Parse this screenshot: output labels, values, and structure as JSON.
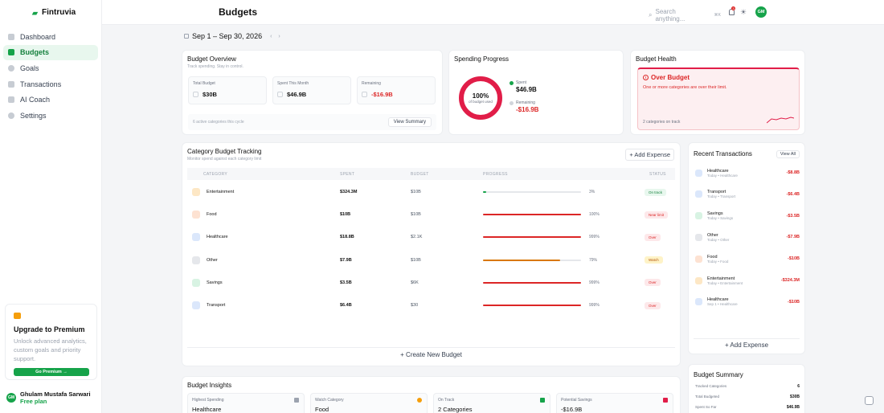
{
  "brand": {
    "name": "Fintruvia",
    "accent": "#16a34a"
  },
  "header": {
    "title": "Budgets",
    "search_placeholder": "Search anything...",
    "kbd": "⌘K",
    "notif_count": "3",
    "avatar": "GM"
  },
  "sidebar": {
    "items": [
      {
        "label": "Dashboard",
        "icon": "grid-icon"
      },
      {
        "label": "Budgets",
        "icon": "wallet-icon",
        "active": true
      },
      {
        "label": "Goals",
        "icon": "target-icon"
      },
      {
        "label": "Transactions",
        "icon": "list-icon"
      },
      {
        "label": "AI Coach",
        "icon": "sparkle-icon"
      },
      {
        "label": "Settings",
        "icon": "gear-icon"
      }
    ],
    "promo": {
      "title": "Upgrade to Premium",
      "text": "Unlock advanced analytics, custom goals and priority support.",
      "button": "Go Premium →"
    },
    "user": {
      "initials": "GM",
      "name": "Ghulam Mustafa Sarwari",
      "plan": "Free plan"
    }
  },
  "date_range": "Sep 1 – Sep 30, 2026",
  "overview": {
    "title": "Budget Overview",
    "subtitle": "Track spending. Stay in control.",
    "stats": [
      {
        "label": "Total Budget",
        "value": "$30B"
      },
      {
        "label": "Spent This Month",
        "value": "$46.9B"
      },
      {
        "label": "Remaining",
        "value": "-$16.9B"
      }
    ],
    "footer": "6 active categories this cycle",
    "button": "View Summary"
  },
  "progress": {
    "title": "Spending Progress",
    "pct": "100%",
    "pct_value": 100,
    "sub": "of budget used",
    "spent_label": "Spent",
    "spent": "$46.9B",
    "remaining_label": "Remaining",
    "remaining": "-$16.9B"
  },
  "health": {
    "title": "Budget Health",
    "status": "Over Budget",
    "text": "One or more categories are over their limit.",
    "footer": "2 categories on track"
  },
  "tracking": {
    "title": "Category Budget Tracking",
    "subtitle": "Monitor spend against each category limit",
    "add_button": "+ Add Expense",
    "columns": {
      "category": "CATEGORY",
      "spent": "SPENT",
      "budget": "BUDGET",
      "progress": "PROGRESS",
      "status": "STATUS"
    },
    "rows": [
      {
        "category": "Entertainment",
        "spent": "$324.3M",
        "budget": "$10B",
        "pct": "3%",
        "fill": 0.03,
        "status": "On track",
        "color": "#16a34a"
      },
      {
        "category": "Food",
        "spent": "$10B",
        "budget": "$10B",
        "pct": "100%",
        "fill": 1,
        "status": "Near limit",
        "color": "#dc2626"
      },
      {
        "category": "Healthcare",
        "spent": "$18.8B",
        "budget": "$2.1K",
        "pct": "999%",
        "fill": 1,
        "status": "Over",
        "color": "#dc2626"
      },
      {
        "category": "Other",
        "spent": "$7.9B",
        "budget": "$10B",
        "pct": "79%",
        "fill": 0.79,
        "status": "Watch",
        "color": "#d97706"
      },
      {
        "category": "Savings",
        "spent": "$3.5B",
        "budget": "$6K",
        "pct": "999%",
        "fill": 1,
        "status": "Over",
        "color": "#dc2626"
      },
      {
        "category": "Transport",
        "spent": "$6.4B",
        "budget": "$30",
        "pct": "999%",
        "fill": 1,
        "status": "Over",
        "color": "#dc2626"
      }
    ],
    "footer": "+ Create New Budget"
  },
  "recent": {
    "title": "Recent Transactions",
    "view_all": "View All",
    "items": [
      {
        "name": "Healthcare",
        "meta": "Today • Healthcare",
        "amount": "-$8.8B"
      },
      {
        "name": "Transport",
        "meta": "Today • Transport",
        "amount": "-$6.4B"
      },
      {
        "name": "Savings",
        "meta": "Today • Savings",
        "amount": "-$3.5B"
      },
      {
        "name": "Other",
        "meta": "Today • Other",
        "amount": "-$7.9B"
      },
      {
        "name": "Food",
        "meta": "Today • Food",
        "amount": "-$10B"
      },
      {
        "name": "Entertainment",
        "meta": "Today • Entertainment",
        "amount": "-$324.3M"
      },
      {
        "name": "Healthcare",
        "meta": "Sep 1 • Healthcare",
        "amount": "-$10B"
      }
    ],
    "footer": "+ Add Expense"
  },
  "insights": {
    "title": "Budget Insights",
    "cards": [
      {
        "label": "Highest Spending",
        "value": "Healthcare"
      },
      {
        "label": "Watch Category",
        "value": "Food"
      },
      {
        "label": "On Track",
        "value": "2 Categories"
      },
      {
        "label": "Potential Savings",
        "value": "-$16.9B"
      }
    ]
  },
  "summary": {
    "title": "Budget Summary",
    "rows": [
      {
        "label": "Tracked Categories",
        "value": "6"
      },
      {
        "label": "Total Budgeted",
        "value": "$30B"
      },
      {
        "label": "Spent So Far",
        "value": "$46.9B"
      }
    ]
  }
}
